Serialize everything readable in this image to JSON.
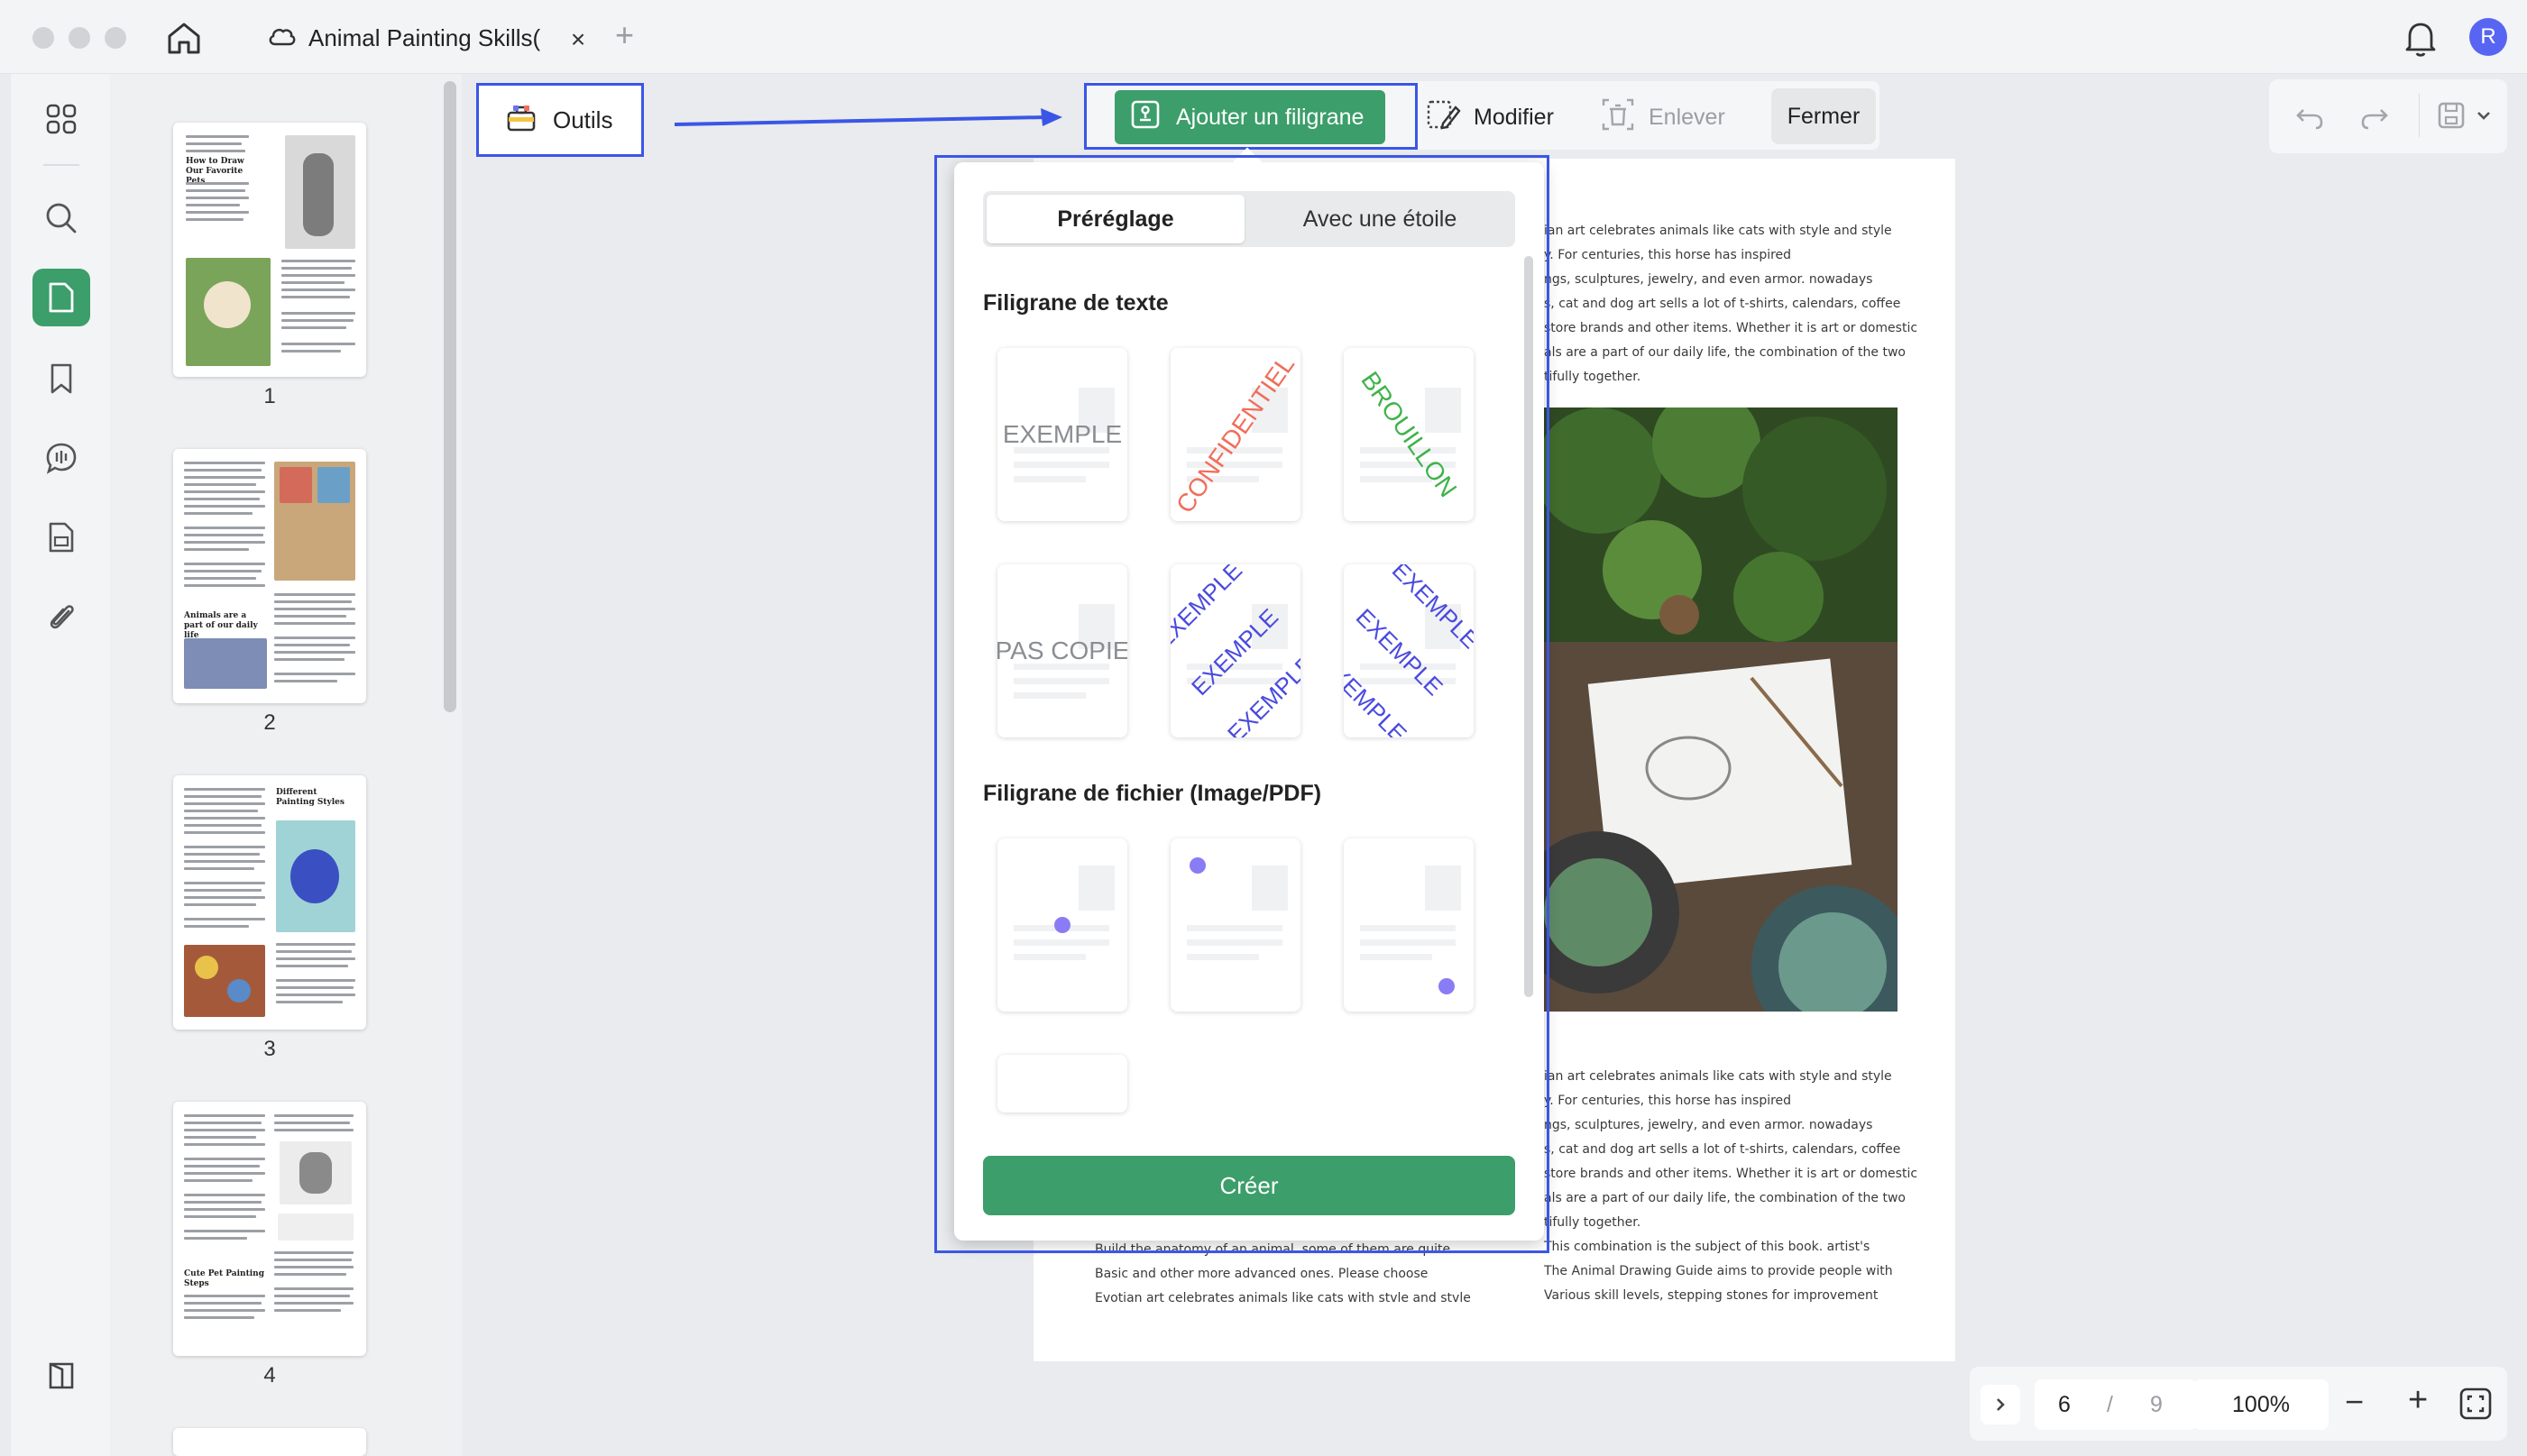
{
  "titlebar": {
    "tab_title": "Animal Painting Skills(",
    "tab_close": "×",
    "tab_add": "+",
    "avatar_initial": "R"
  },
  "toolbar": {
    "tools_label": "Outils",
    "add_watermark_label": "Ajouter un filigrane",
    "edit_label": "Modifier",
    "remove_label": "Enlever",
    "close_label": "Fermer"
  },
  "thumbnails": {
    "pages": [
      {
        "number": "1",
        "heading": "How to Draw Our Favorite Pets"
      },
      {
        "number": "2",
        "heading": "Animals are a part of our daily life"
      },
      {
        "number": "3",
        "heading": "Different Painting Styles"
      },
      {
        "number": "4",
        "heading": "Cute Pet Painting Steps"
      }
    ]
  },
  "panel": {
    "tab_preset": "Préréglage",
    "tab_star": "Avec une étoile",
    "text_section_title": "Filigrane de texte",
    "file_section_title": "Filigrane de fichier (Image/PDF)",
    "text_presets": [
      "EXEMPLE",
      "CONFIDENTIEL",
      "BROUILLON",
      "PAS COPIE",
      "EXEMPLE",
      "EXEMPLE"
    ],
    "create_label": "Créer",
    "colors": {
      "green": "#3c9e6a",
      "confidential": "#f06e5a",
      "draft": "#3fb24a",
      "blue": "#4a4adf",
      "gray": "#8a8d92"
    }
  },
  "document": {
    "top_lines": [
      "ian art celebrates animals like cats with style and style",
      "y. For centuries, this horse has inspired",
      "ngs, sculptures, jewelry, and even armor. nowadays",
      "s, cat and dog art sells a lot of t-shirts, calendars, coffee",
      "store brands and other items. Whether it is art or domestic",
      "als are a part of our daily life, the combination of the two",
      "tifully together."
    ],
    "mid_lines": [
      "ian art celebrates animals like cats with style and style",
      "y. For centuries, this horse has inspired",
      "ngs, sculptures, jewelry, and even armor. nowadays",
      "s, cat and dog art sells a lot of t-shirts, calendars, coffee",
      "store brands and other items. Whether it is art or domestic",
      "als are a part of our daily life, the combination of the two",
      "tifully together.",
      "This combination is the subject of this book. artist's",
      "The Animal Drawing Guide aims to provide people with",
      "Various skill levels, stepping stones for improvement"
    ],
    "left_lines": [
      "Build the anatomy of an animal. some of them are quite",
      "Basic and other more advanced ones. Please choose",
      "Evotian art celebrates animals like cats with stvle and stvle"
    ]
  },
  "pager": {
    "current_page": "6",
    "separator": "/",
    "total_pages": "9",
    "zoom": "100%",
    "zoom_out": "−",
    "zoom_in": "+"
  }
}
